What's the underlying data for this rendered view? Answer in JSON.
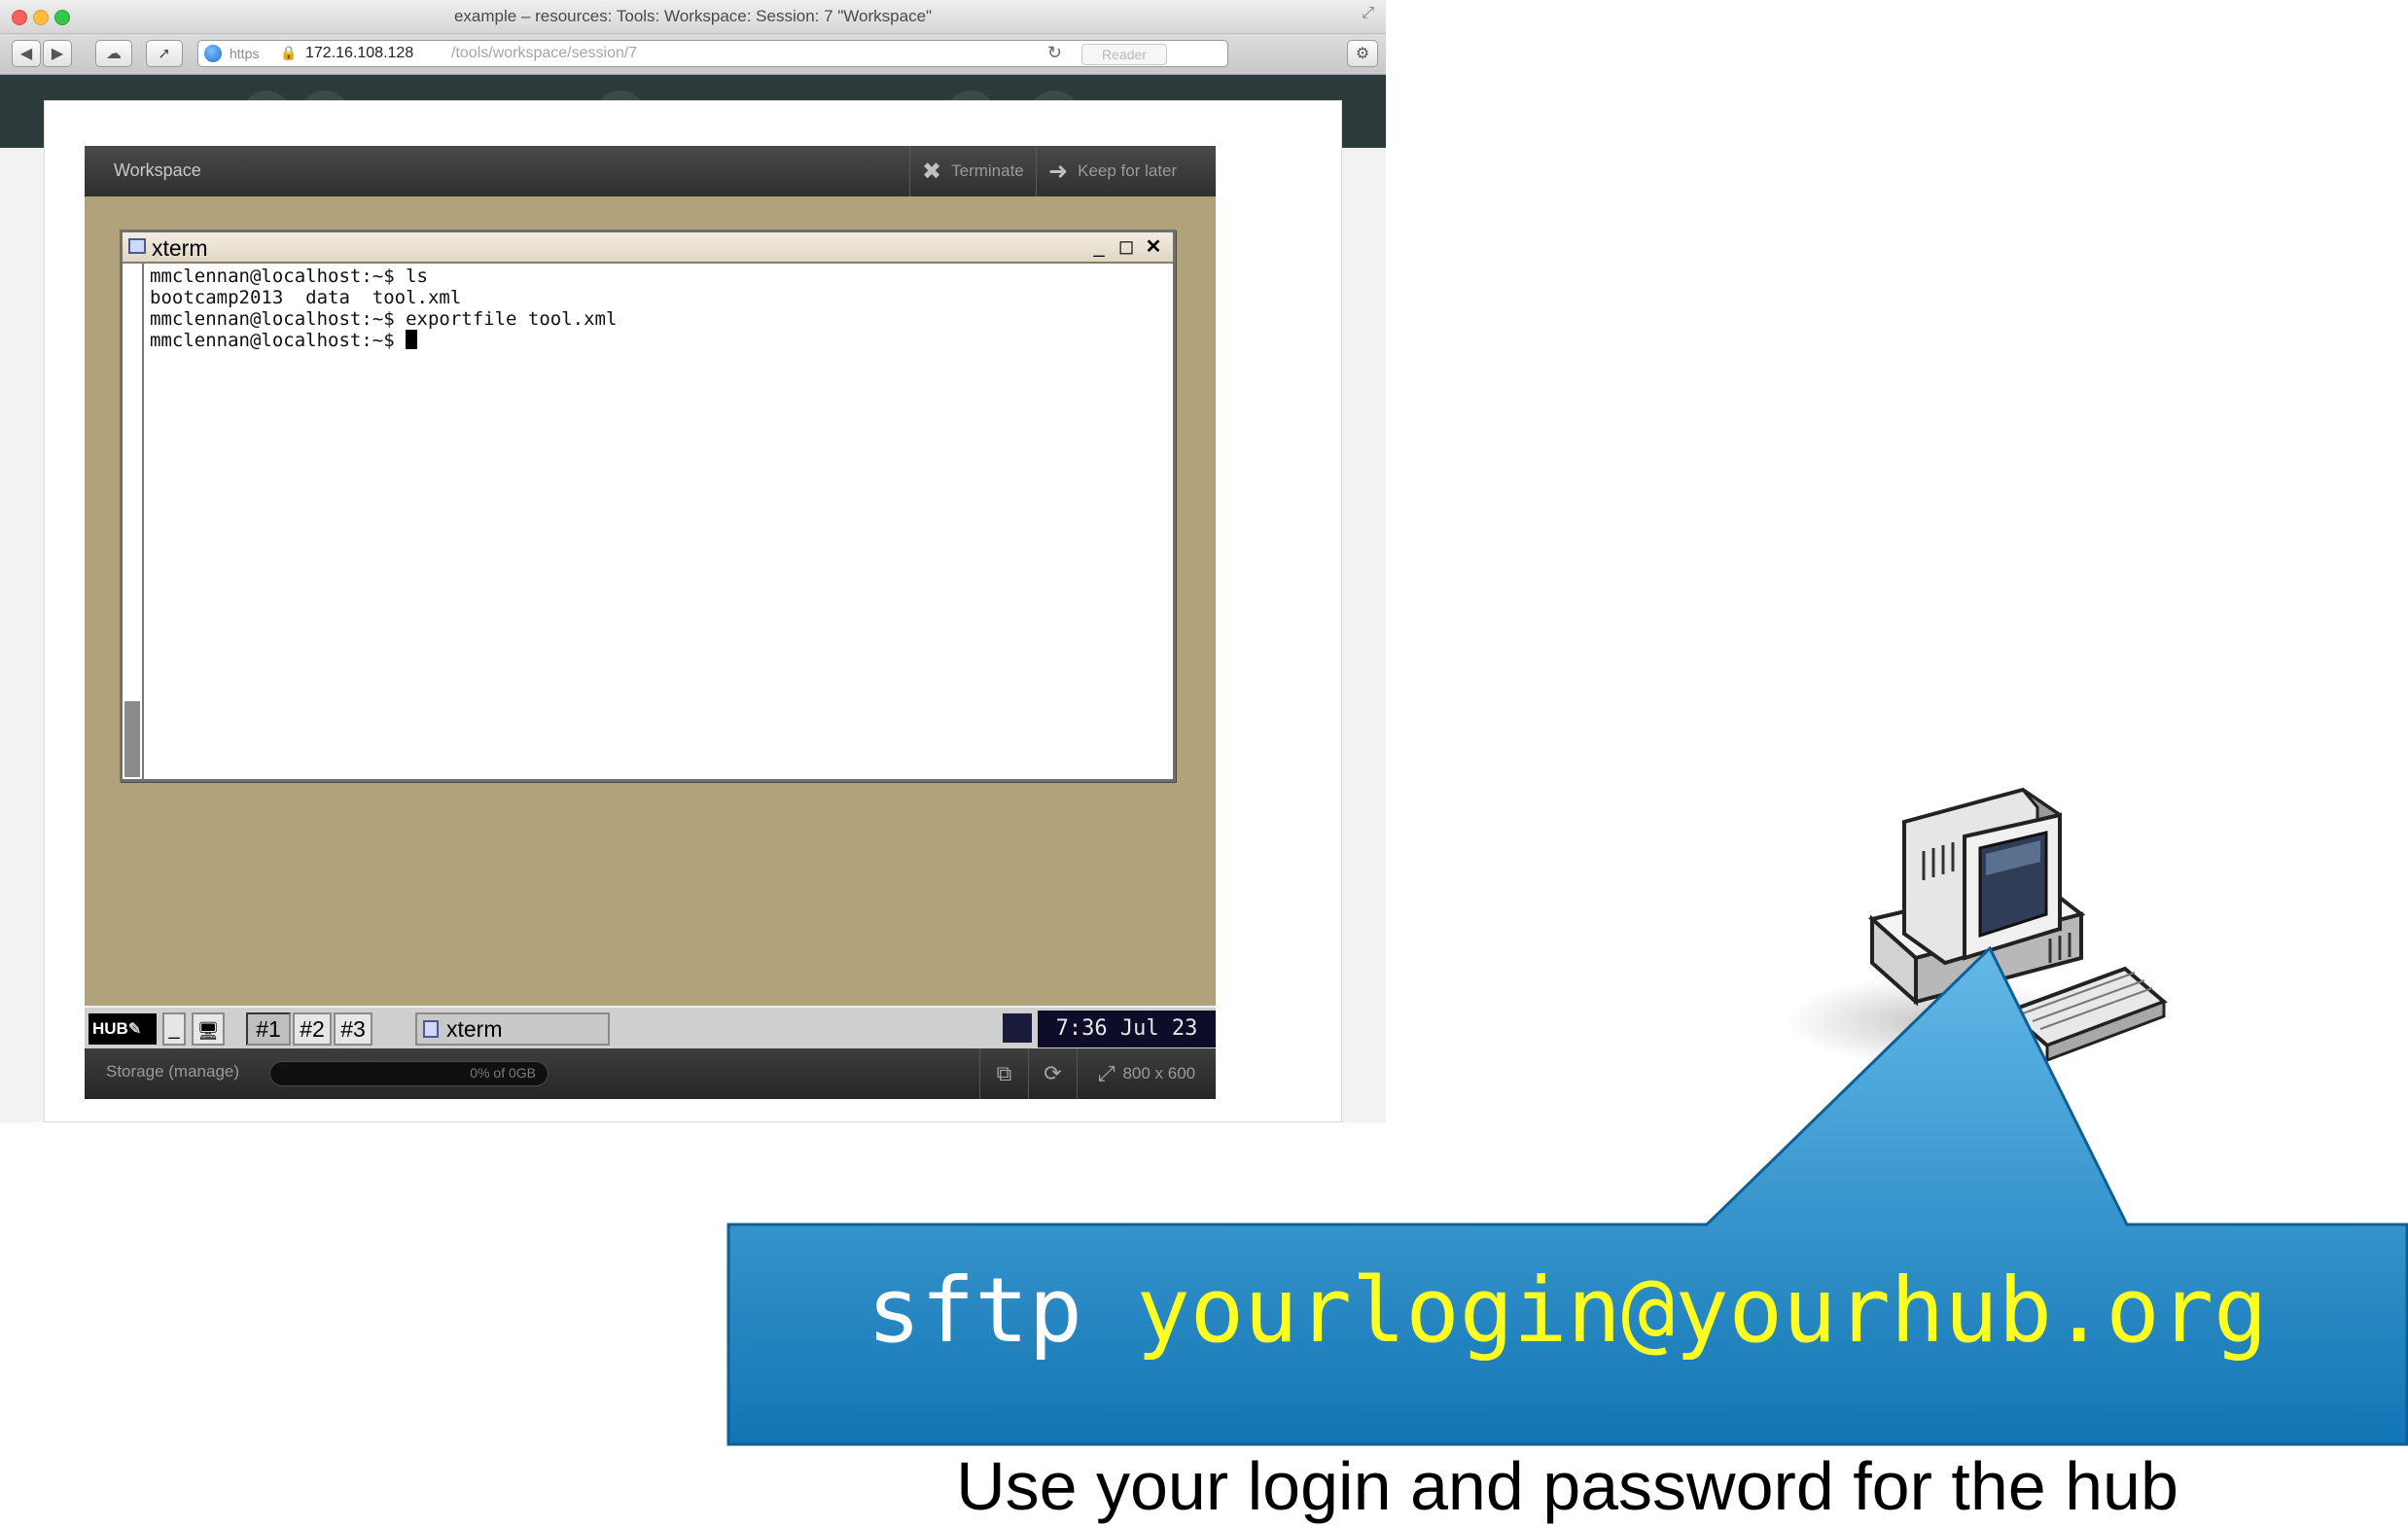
{
  "browser": {
    "window_title": "example – resources: Tools: Workspace: Session: 7 \"Workspace\"",
    "url_protocol": "https",
    "url_host": "172.16.108.128",
    "url_path": "/tools/workspace/session/7",
    "reader_label": "Reader",
    "icons": [
      "back-arrow-icon",
      "forward-arrow-icon",
      "icloud-icon",
      "share-icon",
      "globe-icon",
      "lock-icon",
      "reload-icon",
      "gear-icon",
      "fullscreen-icon"
    ]
  },
  "workspace": {
    "title": "Workspace",
    "terminate_label": "Terminate",
    "keep_label": "Keep for later",
    "xterm_title": "xterm",
    "terminal_lines": [
      "mmclennan@localhost:~$ ls",
      "bootcamp2013  data  tool.xml",
      "mmclennan@localhost:~$ exportfile tool.xml",
      "mmclennan@localhost:~$ "
    ],
    "taskbar": {
      "logo": "HUB",
      "desktops": [
        "#1",
        "#2",
        "#3"
      ],
      "task_label": "xterm",
      "clock": "7:36 Jul 23"
    },
    "status": {
      "storage_label": "Storage (manage)",
      "storage_text": "0% of 0GB",
      "storage_fraction": 0,
      "size_label": "800 x 600"
    }
  },
  "callout": {
    "command": "sftp",
    "target": "yourlogin@yourhub.org",
    "caption": "Use your login and password for the hub",
    "color_top": "#63b9e8",
    "color_bottom": "#1275b4",
    "accent_text_color": "#ffff22"
  }
}
